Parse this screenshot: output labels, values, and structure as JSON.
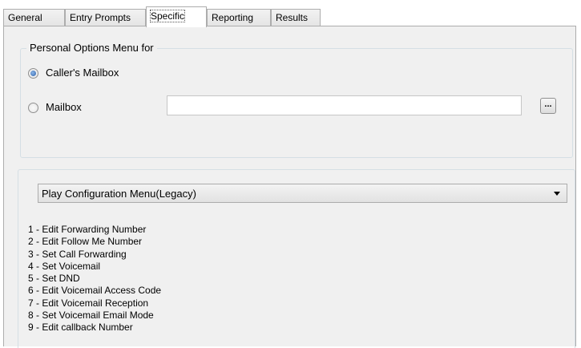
{
  "tabs": [
    {
      "label": "General",
      "active": false
    },
    {
      "label": "Entry Prompts",
      "active": false
    },
    {
      "label": "Specific",
      "active": true
    },
    {
      "label": "Reporting",
      "active": false
    },
    {
      "label": "Results",
      "active": false
    }
  ],
  "personal_options": {
    "legend": "Personal Options Menu for",
    "callers_mailbox_label": "Caller's Mailbox",
    "callers_mailbox_selected": true,
    "mailbox_label": "Mailbox",
    "mailbox_selected": false,
    "mailbox_value": "",
    "browse_label": "..."
  },
  "menu_config": {
    "selected_option": "Play Configuration Menu(Legacy)",
    "items": [
      "1 - Edit Forwarding Number",
      "2 - Edit Follow Me Number",
      "3 - Set Call Forwarding",
      "4 - Set Voicemail",
      "5 - Set DND",
      "6 - Edit Voicemail Access Code",
      "7 - Edit Voicemail Reception",
      "8 - Set Voicemail Email Mode",
      "9 - Edit callback Number"
    ]
  },
  "colors": {
    "panel_background": "#f0f0f0",
    "radio_selected": "#2d5fa8",
    "tab_border": "#adadad"
  }
}
